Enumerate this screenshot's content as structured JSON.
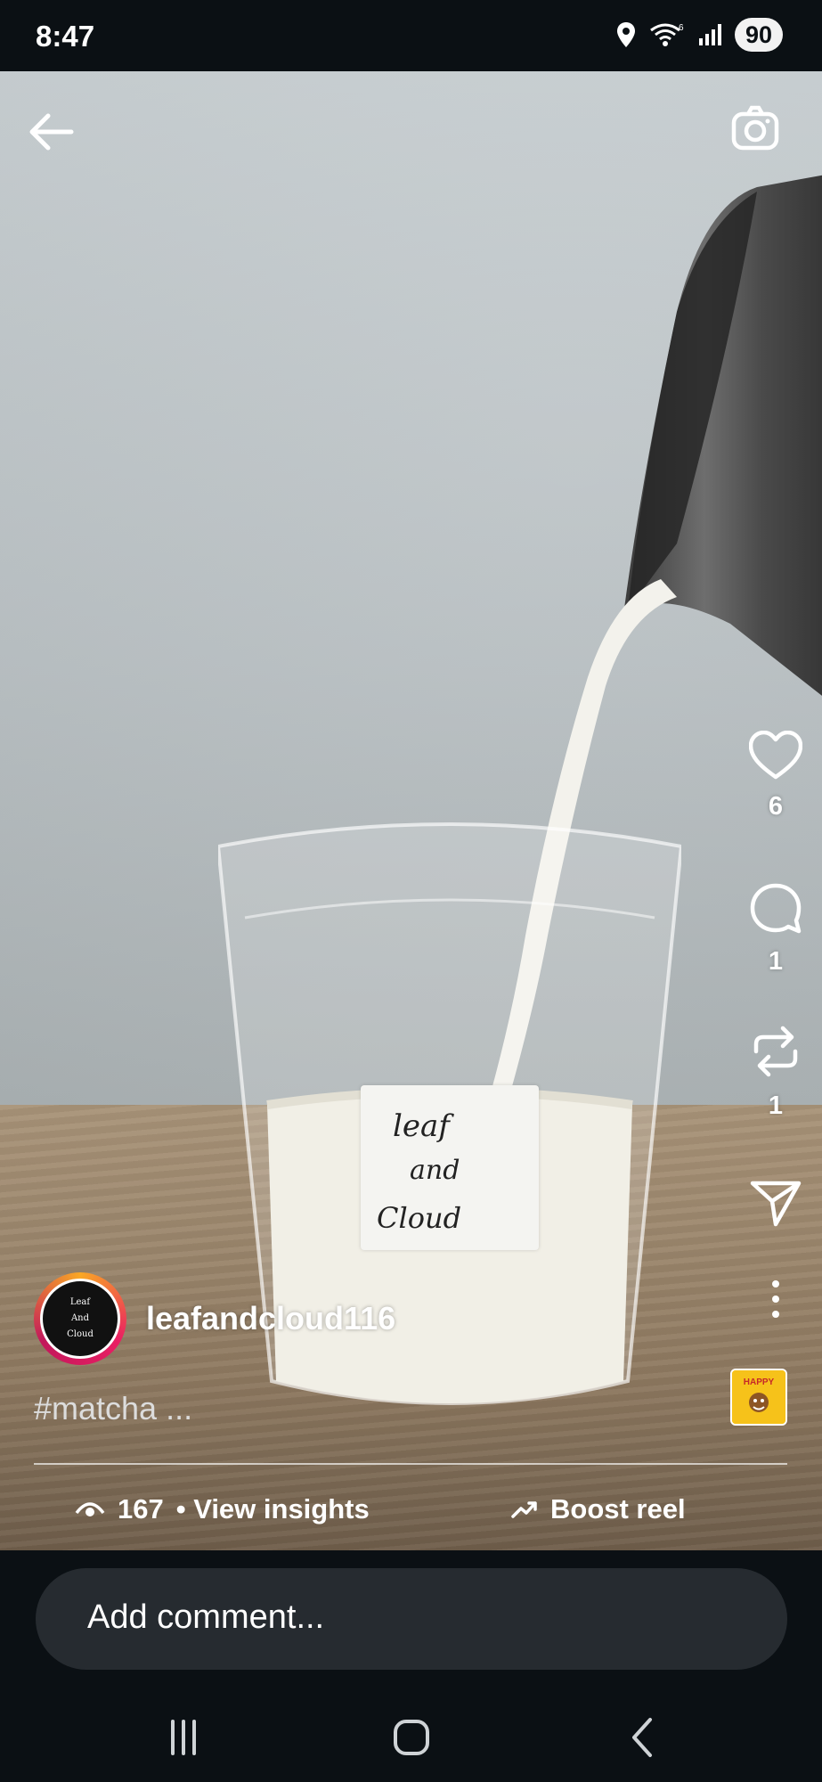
{
  "status": {
    "time": "8:47",
    "battery": "90"
  },
  "video_label": {
    "line1": "leaf",
    "line2": "and",
    "line3": "Cloud"
  },
  "rail": {
    "likes": "6",
    "comments": "1",
    "reposts": "1"
  },
  "author": {
    "username": "leafandcloud116",
    "avatar_text": [
      "Leaf",
      "And",
      "Cloud"
    ]
  },
  "caption": "#matcha ...",
  "stats": {
    "views": "167",
    "insights_label": "• View insights",
    "boost_label": "Boost reel"
  },
  "comment": {
    "placeholder": "Add comment..."
  },
  "music_thumb_text": "HAPPY",
  "colors": {
    "background": "#0b1014",
    "comment_bar": "#262b30",
    "ring_start": "#f9a825",
    "ring_end": "#e91e63"
  },
  "icons": [
    "back-arrow-icon",
    "camera-icon",
    "heart-icon",
    "comment-icon",
    "repost-icon",
    "send-icon",
    "more-icon",
    "eye-icon",
    "trending-icon",
    "recents-icon",
    "home-icon",
    "nav-back-icon"
  ]
}
